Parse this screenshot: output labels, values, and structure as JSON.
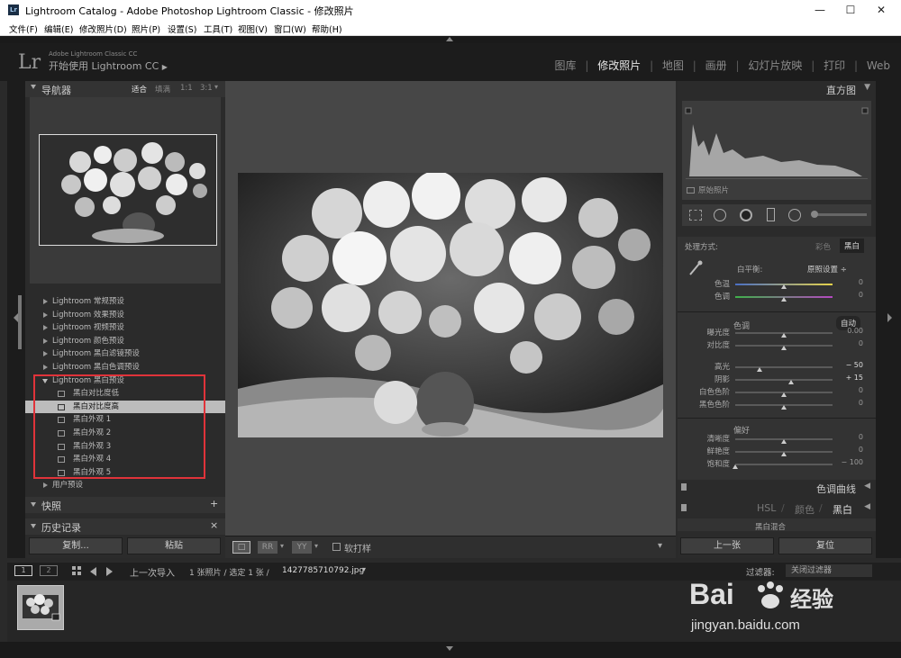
{
  "window": {
    "title": "Lightroom Catalog - Adobe Photoshop Lightroom Classic - 修改照片",
    "app_icon": "Lr",
    "controls": [
      "—",
      "☐",
      "✕"
    ]
  },
  "menu": [
    "文件(F)",
    "编辑(E)",
    "修改照片(D)",
    "照片(P)",
    "设置(S)",
    "工具(T)",
    "视图(V)",
    "窗口(W)",
    "帮助(H)"
  ],
  "identity": {
    "logo": "Lr",
    "product": "Adobe Lightroom Classic CC",
    "start": "开始使用 Lightroom CC",
    "start_arrow": "▶"
  },
  "modules": {
    "items": [
      "图库",
      "修改照片",
      "地图",
      "画册",
      "幻灯片放映",
      "打印",
      "Web"
    ],
    "separator": "|",
    "active": "修改照片"
  },
  "navigator": {
    "title": "导航器",
    "zoom_options": [
      "适合",
      "填满",
      "1:1",
      "3:1"
    ],
    "zoom_menu": "▾"
  },
  "presets": {
    "folders_collapsed": [
      "Lightroom 常规预设",
      "Lightroom 效果预设",
      "Lightroom 视频预设",
      "Lightroom 颜色预设",
      "Lightroom 黑白滤镜预设",
      "Lightroom 黑白色调预设"
    ],
    "open_folder": "Lightroom 黑白预设",
    "items": [
      "黑白对比度低",
      "黑白对比度高",
      "黑白外观 1",
      "黑白外观 2",
      "黑白外观 3",
      "黑白外观 4",
      "黑白外观 5"
    ],
    "selected_index": 1,
    "user_folder": "用户预设"
  },
  "left_sections": {
    "snapshots": "快照",
    "snapshots_add": "+",
    "history": "历史记录",
    "history_clear": "×"
  },
  "left_buttons": {
    "copy": "复制...",
    "paste": "粘贴"
  },
  "toolbar": {
    "view_loupe": "□",
    "view_before_after": "RR",
    "view_yy": "YY",
    "dropdown": "▾",
    "softproof_label": "软打样",
    "menu": "▾"
  },
  "histogram": {
    "title": "直方图",
    "original_label": "原始照片",
    "collapse": "▼"
  },
  "basic": {
    "treatment_label": "处理方式:",
    "color": "彩色",
    "bw": "黑白",
    "wb_label": "白平衡:",
    "wb_value": "原照设置 ÷",
    "tone_label": "色调",
    "auto": "自动",
    "presence": "偏好",
    "sliders": [
      {
        "label": "色温",
        "value": "0",
        "pos": 0.5
      },
      {
        "label": "色调",
        "value": "0",
        "pos": 0.5
      },
      {
        "label": "曝光度",
        "value": "0.00",
        "pos": 0.5
      },
      {
        "label": "对比度",
        "value": "0",
        "pos": 0.5
      },
      {
        "label": "高光",
        "value": "− 50",
        "pos": 0.25
      },
      {
        "label": "阴影",
        "value": "+ 15",
        "pos": 0.57
      },
      {
        "label": "白色色阶",
        "value": "0",
        "pos": 0.5
      },
      {
        "label": "黑色色阶",
        "value": "0",
        "pos": 0.5
      },
      {
        "label": "清晰度",
        "value": "0",
        "pos": 0.5
      },
      {
        "label": "鲜艳度",
        "value": "0",
        "pos": 0.5
      },
      {
        "label": "饱和度",
        "value": "− 100",
        "pos": 0.0
      }
    ]
  },
  "right_sections": {
    "tone_curve": "色调曲线",
    "hsl": "HSL",
    "hsl_color": "颜色",
    "hsl_bw": "黑白",
    "separator": "/",
    "bw_mix": "黑白混合",
    "collapse_left": "◀"
  },
  "right_buttons": {
    "previous": "上一张",
    "reset": "复位"
  },
  "filmstrip_bar": {
    "view1": "1",
    "view2": "2",
    "source": "上一次导入",
    "count": "1 张照片 / 选定 1 张 /",
    "filename": "1427785710792.jpg",
    "filename_menu": "▾",
    "filter_label": "过滤器:",
    "filter_value": "关闭过滤器"
  },
  "watermark": {
    "brand": "Bai",
    "brand2": "经验",
    "url": "jingyan.baidu.com"
  }
}
